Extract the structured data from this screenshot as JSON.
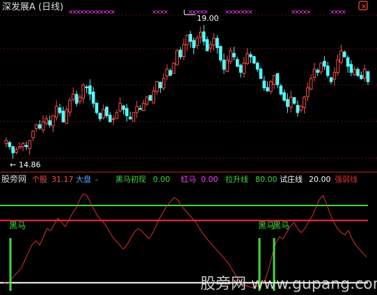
{
  "top_panel": {
    "title": "深发展A (日线)",
    "high_label": "19.00",
    "low_label": "14.86",
    "marker_glyph": "×",
    "icon": "close-icon"
  },
  "indicator_bar": {
    "name": "股旁网",
    "stock_label": "个股",
    "stock_value": "31.17",
    "market_label": "大盘",
    "market_value": "-",
    "heima_label": "黑马初现",
    "heima_value": "0.00",
    "hongma_label": "红马",
    "hongma_value": "0.00",
    "lasheng_label": "拉升线",
    "lasheng_value": "80.00",
    "shizhuang_label": "试庄线",
    "shizhuang_value": "20.00",
    "qiangruo_label": "强弱线"
  },
  "bottom_panel": {
    "heima_markers": [
      "黑马",
      "黑马",
      "黑马"
    ],
    "watermark": "股旁网 www.gupang.com"
  },
  "colors": {
    "up": "#ff4d4d",
    "down": "#53ffff",
    "green_line": "#3fdc3f",
    "red_line": "#ff3030",
    "white_line": "#ffffff",
    "strength_line": "#e03030",
    "magenta": "#ff40ff"
  },
  "chart_data": [
    {
      "type": "candlestick",
      "title": "深发展A (日线)",
      "price_annotations": [
        {
          "label": "19.00",
          "value": 19.0
        },
        {
          "label": "14.86",
          "value": 14.86
        }
      ],
      "ylim": [
        14.5,
        19.3
      ],
      "closes": [
        15.3,
        15.1,
        14.9,
        15.0,
        15.1,
        15.2,
        15.1,
        15.3,
        15.6,
        15.8,
        15.7,
        15.9,
        16.0,
        15.8,
        16.1,
        16.4,
        16.2,
        15.9,
        16.3,
        16.6,
        16.8,
        16.5,
        16.7,
        17.1,
        17.0,
        16.8,
        16.5,
        16.2,
        16.0,
        16.3,
        16.1,
        15.9,
        16.0,
        16.2,
        16.5,
        16.3,
        16.1,
        16.0,
        16.2,
        16.4,
        16.3,
        16.5,
        16.7,
        16.6,
        16.9,
        17.2,
        17.0,
        17.3,
        17.6,
        17.4,
        17.8,
        18.2,
        18.0,
        18.4,
        18.7,
        18.5,
        18.3,
        18.6,
        18.8,
        18.5,
        18.2,
        18.4,
        18.6,
        18.3,
        17.9,
        17.6,
        17.9,
        18.2,
        18.0,
        17.7,
        17.5,
        17.8,
        18.1,
        18.0,
        17.8,
        17.6,
        17.3,
        17.0,
        16.9,
        17.2,
        17.4,
        17.1,
        16.8,
        16.6,
        16.4,
        16.7,
        16.5,
        16.2,
        16.4,
        16.7,
        17.0,
        17.3,
        17.6,
        17.5,
        17.8,
        17.7,
        17.4,
        17.2,
        17.5,
        17.9,
        18.2,
        18.0,
        17.7,
        17.5,
        17.6,
        17.4,
        17.3,
        17.6,
        17.2
      ]
    },
    {
      "type": "line",
      "series": [
        {
          "name": "个股",
          "values": [
            8,
            6,
            10,
            14,
            18,
            22,
            30,
            38,
            45,
            48,
            44,
            52,
            60,
            58,
            64,
            70,
            66,
            62,
            68,
            75,
            80,
            88,
            94,
            92,
            85,
            78,
            72,
            68,
            64,
            58,
            52,
            48,
            44,
            40,
            44,
            50,
            56,
            60,
            58,
            54,
            50,
            55,
            62,
            70,
            76,
            82,
            86,
            90,
            88,
            82,
            78,
            74,
            70,
            66,
            60,
            55,
            50,
            46,
            42,
            38,
            34,
            30,
            26,
            20,
            14,
            10,
            6,
            4,
            3,
            2,
            4,
            6,
            10,
            20,
            34,
            46,
            52,
            50,
            56,
            62,
            66,
            60,
            56,
            60,
            66,
            72,
            80,
            88,
            92,
            84,
            74,
            66,
            60,
            56,
            54,
            58,
            50,
            44,
            40,
            36,
            32
          ]
        }
      ],
      "levels": {
        "lasheng": 80,
        "shizhuang": 20
      },
      "ylim": [
        0,
        100
      ]
    }
  ]
}
